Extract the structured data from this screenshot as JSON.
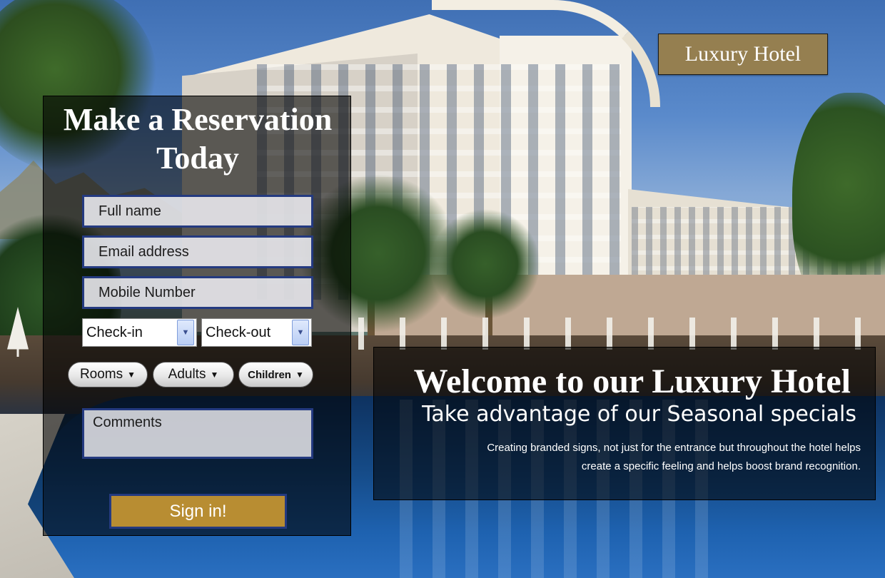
{
  "logo": {
    "text": "Luxury Hotel"
  },
  "reservation": {
    "title": "Make a Reservation Today",
    "full_name_placeholder": "Full name",
    "email_placeholder": "Email address",
    "mobile_placeholder": "Mobile Number",
    "checkin_label": "Check-in",
    "checkout_label": "Check-out",
    "rooms_label": "Rooms",
    "adults_label": "Adults",
    "children_label": "Children",
    "comments_placeholder": "Comments",
    "signin_label": "Sign in!"
  },
  "welcome": {
    "title": "Welcome to our Luxury Hotel",
    "subtitle": "Take advantage of our Seasonal specials",
    "text": "Creating branded signs, not just for the entrance but throughout the hotel helps create a specific feeling and helps boost brand recognition."
  },
  "colors": {
    "logo_bg": "#957f50",
    "signin_bg": "#b88d32",
    "field_border": "#243a80"
  },
  "icons": {
    "dropdown": "chevron-down-icon",
    "pill_arrow": "caret-down-icon"
  }
}
